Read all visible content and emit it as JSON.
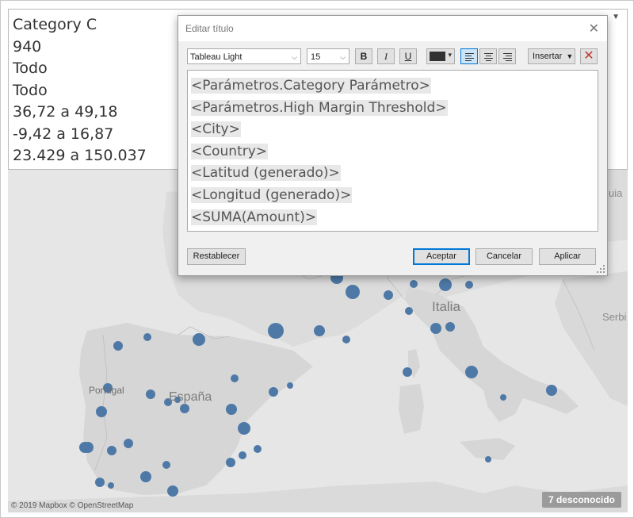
{
  "title_panel": {
    "lines": [
      "Category C",
      "940",
      "Todo",
      "Todo",
      "36,72 a 49,18",
      "-9,42 a 16,87",
      "23.429 a 150.037"
    ]
  },
  "dialog": {
    "title": "Editar título",
    "font": "Tableau Light",
    "size": "15",
    "bold": "B",
    "italic": "I",
    "underline": "U",
    "text_color": "#333333",
    "insert_label": "Insertar",
    "editor_lines": [
      "<Parámetros.Category Parámetro>",
      "<Parámetros.High Margin Threshold>",
      "<City>",
      "<Country>",
      "<Latitud (generado)>",
      "<Longitud (generado)>",
      "<SUMA(Amount)>"
    ],
    "reset_label": "Restablecer",
    "ok_label": "Aceptar",
    "cancel_label": "Cancelar",
    "apply_label": "Aplicar"
  },
  "map": {
    "labels": {
      "italia": "Italia",
      "espana": "España",
      "portugal": "Portugal",
      "serbia_partial": "Serbi",
      "partial_top": "uia"
    },
    "attribution": "© 2019 Mapbox © OpenStreetMap",
    "unknown_badge": "7 desconocido",
    "marker_color": "#4e79a7"
  }
}
